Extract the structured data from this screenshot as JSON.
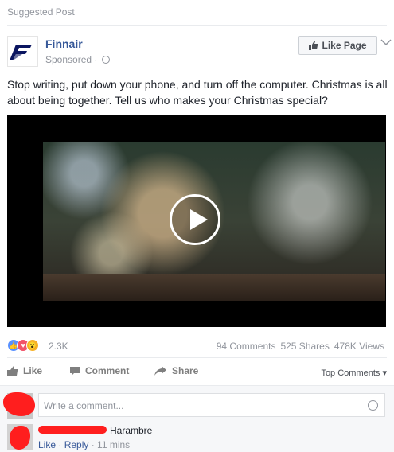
{
  "post": {
    "suggested_label": "Suggested Post",
    "page_name": "Finnair",
    "sponsored_label": "Sponsored",
    "sponsored_sep": " · ",
    "like_page_label": "Like Page",
    "text": "Stop writing, put down your phone, and turn off the computer. Christmas is all about being together. Tell us who makes your Christmas special?"
  },
  "stats": {
    "reaction_count": "2.3K",
    "comments": "94 Comments",
    "shares": "525 Shares",
    "views": "478K Views"
  },
  "actions": {
    "like": "Like",
    "comment": "Comment",
    "share": "Share",
    "top_comments": "Top Comments ▾"
  },
  "comment_box": {
    "placeholder": "Write a comment..."
  },
  "comment": {
    "author_visible": "Harambre",
    "like_label": "Like",
    "reply_label": "Reply",
    "time": "11 mins",
    "sep": " · "
  },
  "colors": {
    "brand_blue": "#365899",
    "finnair_blue": "#0b1560",
    "redaction": "#ff1e1e"
  }
}
